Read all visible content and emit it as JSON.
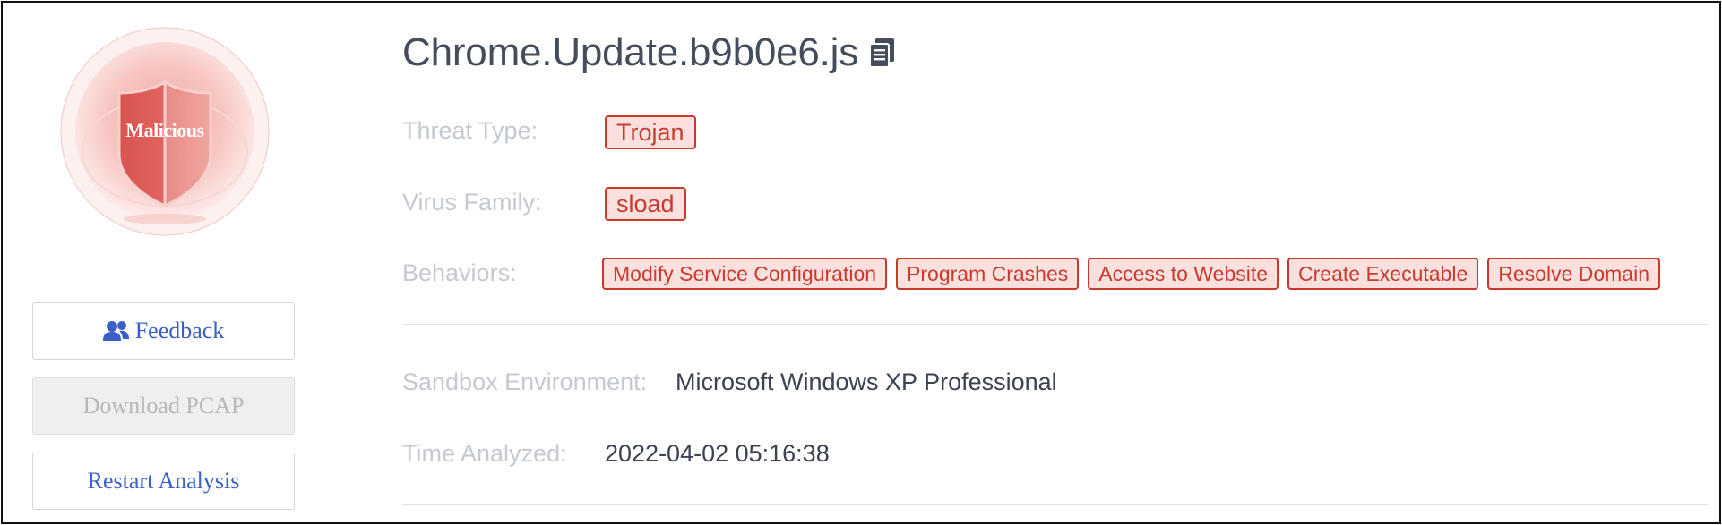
{
  "verdict": {
    "label": "Malicious",
    "colors": {
      "shield": "#d9534f",
      "halo": "#fbe3e1"
    }
  },
  "file": {
    "name": "Chrome.Update.b9b0e6.js",
    "copy_icon": "copy-icon"
  },
  "threat_type": {
    "label": "Threat Type:",
    "value": "Trojan"
  },
  "virus_family": {
    "label": "Virus Family:",
    "value": "sload"
  },
  "behaviors": {
    "label": "Behaviors:",
    "items": [
      "Modify Service Configuration",
      "Program Crashes",
      "Access to Website",
      "Create Executable",
      "Resolve Domain"
    ]
  },
  "sandbox": {
    "label": "Sandbox Environment:",
    "value": "Microsoft Windows XP Professional"
  },
  "time": {
    "label": "Time Analyzed:",
    "value": "2022-04-02 05:16:38"
  },
  "actions": {
    "feedback": "Feedback",
    "download_pcap": "Download PCAP",
    "restart": "Restart Analysis"
  },
  "colors": {
    "tag_border": "#c93a2e",
    "tag_bg": "#fbe0dd",
    "link": "#3b5fc7",
    "label": "#c5c9d1"
  }
}
